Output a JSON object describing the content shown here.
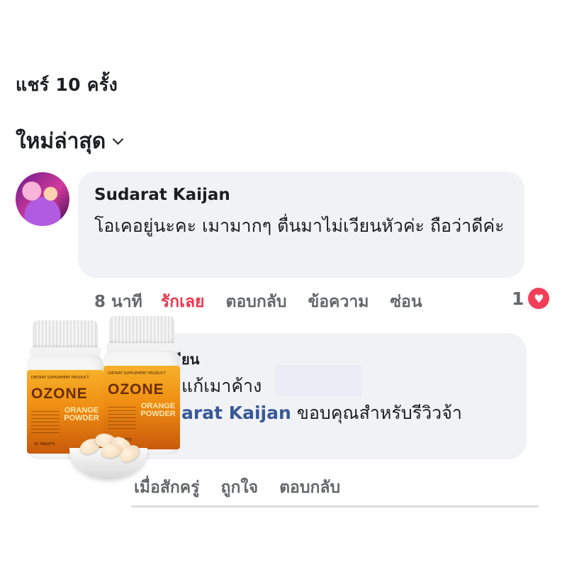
{
  "header": {
    "share_text": "แชร์ 10 ครั้ง",
    "sort_label": "ใหม่ล่าสุด",
    "sort_icon": "chevron-down-icon"
  },
  "comment": {
    "author": "Sudarat Kaijan",
    "text": "โอเคอยู่นะคะ เมามากๆ ตื่นมาไม่เวียนหัวค่ะ ถือว่าดีค่ะ",
    "time": "8 นาที",
    "actions": [
      "รักเลย",
      "ตอบกลับ",
      "ข้อความ",
      "ซ่อน"
    ],
    "reaction_count": "1",
    "reaction_icon": "heart-icon"
  },
  "reply": {
    "author_partial": "ียน",
    "text_line1": "แก้เมาค้าง",
    "mention": "arat Kaijan",
    "text_line2": " ขอบคุณสำหรับรีวิวจ้า",
    "time": "เมื่อสักครู่",
    "actions": [
      "ถูกใจ",
      "ตอบกลับ"
    ]
  },
  "product": {
    "brand": "OZONE",
    "product_name": "ORANGE POWDER",
    "subtitle": "DIETARY SUPPLEMENT PRODUCT",
    "tablets": "30 TABLETS"
  },
  "colors": {
    "love": "#e8384f",
    "mention": "#385898",
    "bubble": "#f0f2f5"
  }
}
